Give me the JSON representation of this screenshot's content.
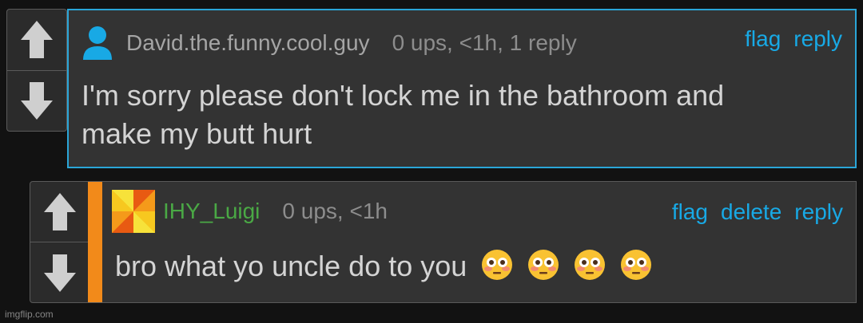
{
  "comments": [
    {
      "username": "David.the.funny.cool.guy",
      "stats": "0 ups, <1h, 1 reply",
      "actions": [
        "flag",
        "reply"
      ],
      "text_line1": "I'm sorry please don't lock me in the bathroom and",
      "text_line2": "make my butt hurt",
      "avatar": "person-icon",
      "highlight_color": "#2aa6d8"
    },
    {
      "username": "IHY_Luigi",
      "stats": "0 ups, <1h",
      "actions": [
        "flag",
        "delete",
        "reply"
      ],
      "text": "bro what yo uncle do to you",
      "emojis": [
        "flushed-face",
        "flushed-face",
        "flushed-face",
        "flushed-face"
      ],
      "avatar": "pinwheel-avatar",
      "username_color": "#4aa845",
      "side_bar_color": "#f28a1a"
    }
  ],
  "vote_icons": [
    "upvote-arrow-icon",
    "downvote-arrow-icon"
  ],
  "link_color": "#18a9e5",
  "watermark": "imgflip.com"
}
